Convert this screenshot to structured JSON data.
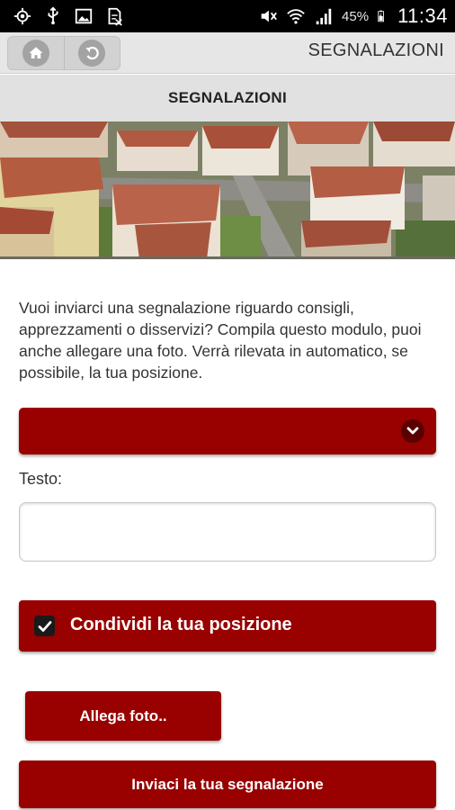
{
  "status_bar": {
    "left_icons": [
      "gps-icon",
      "usb-icon",
      "image-icon",
      "sim-off-icon"
    ],
    "right_icons": [
      "mute-icon",
      "wifi-icon",
      "signal-icon",
      "battery-icon"
    ],
    "battery_percent": "45%",
    "time": "11:34"
  },
  "header": {
    "home_icon": "home-icon",
    "back_icon": "back-icon",
    "title": "SEGNALAZIONI"
  },
  "page": {
    "title": "SEGNALAZIONI",
    "banner": "aerial-town-photo"
  },
  "form": {
    "intro": "Vuoi inviarci una segnalazione riguardo consigli, apprezzamenti o disservizi? Compila questo modulo, puoi anche allegare una foto. Verrà rilevata in automatico, se possibile, la tua posizione.",
    "category_select": {
      "value": ""
    },
    "text_label": "Testo:",
    "text_value": "",
    "share_position": {
      "label": "Condividi la tua posizione",
      "checked": true
    },
    "attach_photo_label": "Allega foto..",
    "submit_label": "Inviaci la tua segnalazione"
  },
  "colors": {
    "accent": "#990000",
    "header_bg": "#e6e6e6",
    "status_bar_bg": "#000000"
  }
}
